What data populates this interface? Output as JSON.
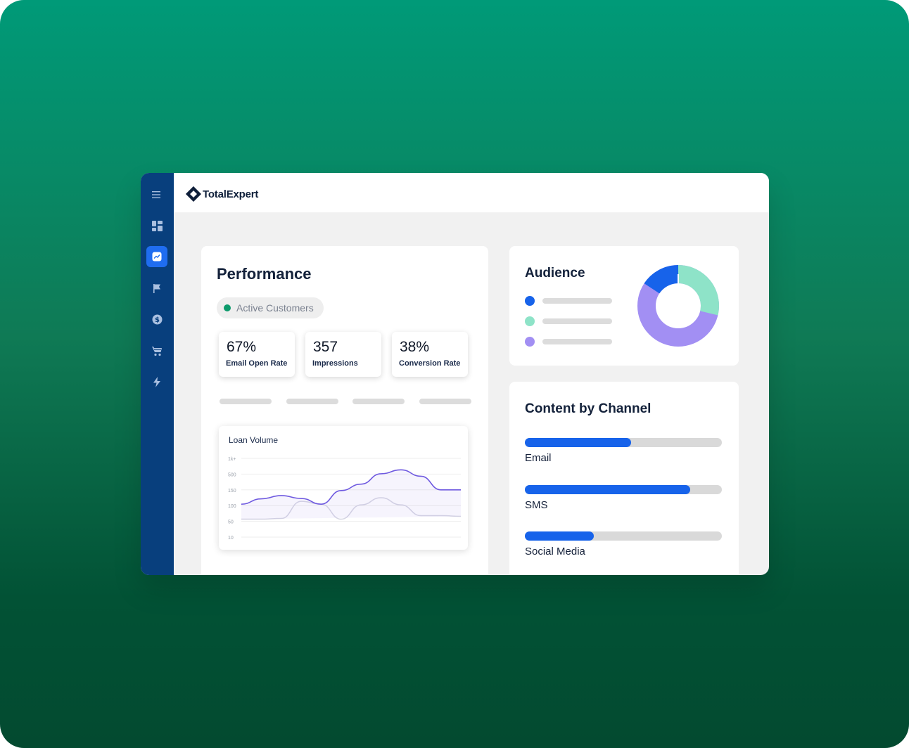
{
  "brand": {
    "name": "TotalExpert"
  },
  "sidebar": {
    "items": [
      {
        "icon": "menu-icon",
        "active": false
      },
      {
        "icon": "dashboard-icon",
        "active": false
      },
      {
        "icon": "analytics-icon",
        "active": true
      },
      {
        "icon": "flag-icon",
        "active": false
      },
      {
        "icon": "dollar-icon",
        "active": false
      },
      {
        "icon": "cart-icon",
        "active": false
      },
      {
        "icon": "lightning-icon",
        "active": false
      }
    ]
  },
  "performance": {
    "title": "Performance",
    "filter_label": "Active Customers",
    "stats": [
      {
        "value": "67%",
        "label": "Email Open Rate"
      },
      {
        "value": "357",
        "label": "Impressions"
      },
      {
        "value": "38%",
        "label": "Conversion Rate"
      }
    ],
    "loan_chart": {
      "title": "Loan Volume",
      "y_ticks": [
        "1k+",
        "500",
        "150",
        "100",
        "50",
        "10"
      ]
    }
  },
  "audience": {
    "title": "Audience",
    "segment_colors": [
      "#1763ea",
      "#8ee3c8",
      "#a28ff3"
    ]
  },
  "channel": {
    "title": "Content by Channel",
    "items": [
      {
        "label": "Email",
        "fraction": 0.54
      },
      {
        "label": "SMS",
        "fraction": 0.84
      },
      {
        "label": "Social Media",
        "fraction": 0.35
      }
    ]
  },
  "colors": {
    "accent": "#1763ea",
    "sidebar": "#083f7d",
    "active_dot": "#0b9a6b",
    "line_primary": "#6f5ae0",
    "line_secondary": "#d6d6e3"
  },
  "chart_data": {
    "type": "line",
    "title": "Loan Volume",
    "y_tick_labels": [
      "1k+",
      "500",
      "150",
      "100",
      "50",
      "10"
    ],
    "series": [
      {
        "values": [
          92,
          107,
          116,
          108,
          92,
          130,
          148,
          177,
          188,
          170,
          132,
          132
        ]
      },
      {
        "values": [
          50,
          50,
          52,
          100,
          92,
          50,
          90,
          110,
          90,
          60,
          60,
          58
        ]
      }
    ],
    "grid": true
  }
}
